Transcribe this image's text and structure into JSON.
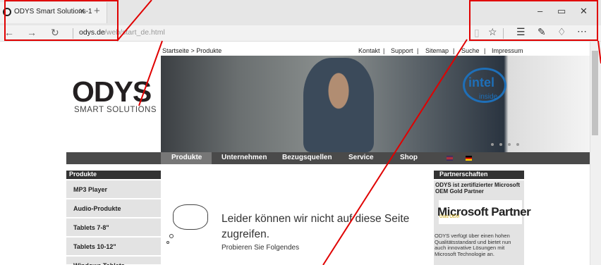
{
  "browser": {
    "tab_title": "ODYS Smart Solutions-1",
    "tab_close": "×",
    "new_tab": "+",
    "window_min": "–",
    "window_restore": "▭",
    "window_close": "✕",
    "back": "←",
    "forward": "→",
    "refresh": "↻",
    "url_host": "odys.de",
    "url_path": "/web/start_de.html",
    "toolbar_icons": [
      "reading-view-icon",
      "favorite-star-icon",
      "hub-icon",
      "web-note-icon",
      "share-icon",
      "more-icon"
    ],
    "more": "⋯"
  },
  "site": {
    "breadcrumb": "Startseite > Produkte",
    "top_links": [
      "Kontakt",
      "|",
      "Support",
      "|",
      "Sitemap",
      "|",
      "Suche",
      "|",
      "Impressum"
    ],
    "logo_word": "ODYS",
    "logo_sub": "SMART SOLUTIONS",
    "intel_word": "intel",
    "intel_inside": "inside",
    "menu": [
      "Produkte",
      "Unternehmen",
      "Bezugsquellen",
      "Service",
      "Shop"
    ],
    "sidebar_heading": "Produkte",
    "sidebar_items": [
      "MP3 Player",
      "Audio-Produkte",
      "Tablets 7-8\"",
      "Tablets 10-12\"",
      "Windows Tablets"
    ],
    "right_heading": "Partnerschaften",
    "right_intro": "ODYS ist zertifizierter Microsoft OEM Gold Partner",
    "ms_logo": "Microsoft Partner",
    "ms_gold": "Gold OEM",
    "right_text": "ODYS verfügt über einen hohen Qualitätsstandard und bietet nun auch innovative Lösungen mit Microsoft Technologie an."
  },
  "error": {
    "title": "Leider können wir nicht auf diese Seite zugreifen.",
    "subtitle": "Probieren Sie Folgendes"
  },
  "colors": {
    "annotation": "#e00000",
    "menu_bar": "#4a4a4a",
    "intel_blue": "#1e6fb8"
  }
}
